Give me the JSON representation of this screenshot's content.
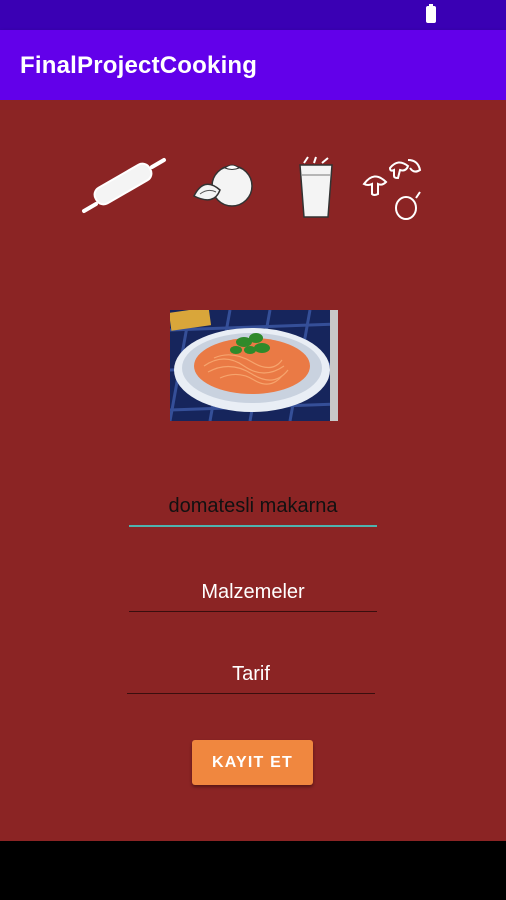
{
  "app": {
    "title": "FinalProjectCooking"
  },
  "colors": {
    "status_bar": "#3a00b4",
    "app_bar": "#6200ea",
    "background": "#8b2424",
    "button": "#f0873f",
    "field_focus_line": "#4fb3ae"
  },
  "icons": [
    "rolling-pin-icon",
    "tomato-icon",
    "cup-icon",
    "mushroom-icon"
  ],
  "form": {
    "name_value": "domatesli makarna",
    "ingredients_value": "Malzemeler",
    "recipe_value": "Tarif",
    "save_label": "KAYIT ET"
  }
}
